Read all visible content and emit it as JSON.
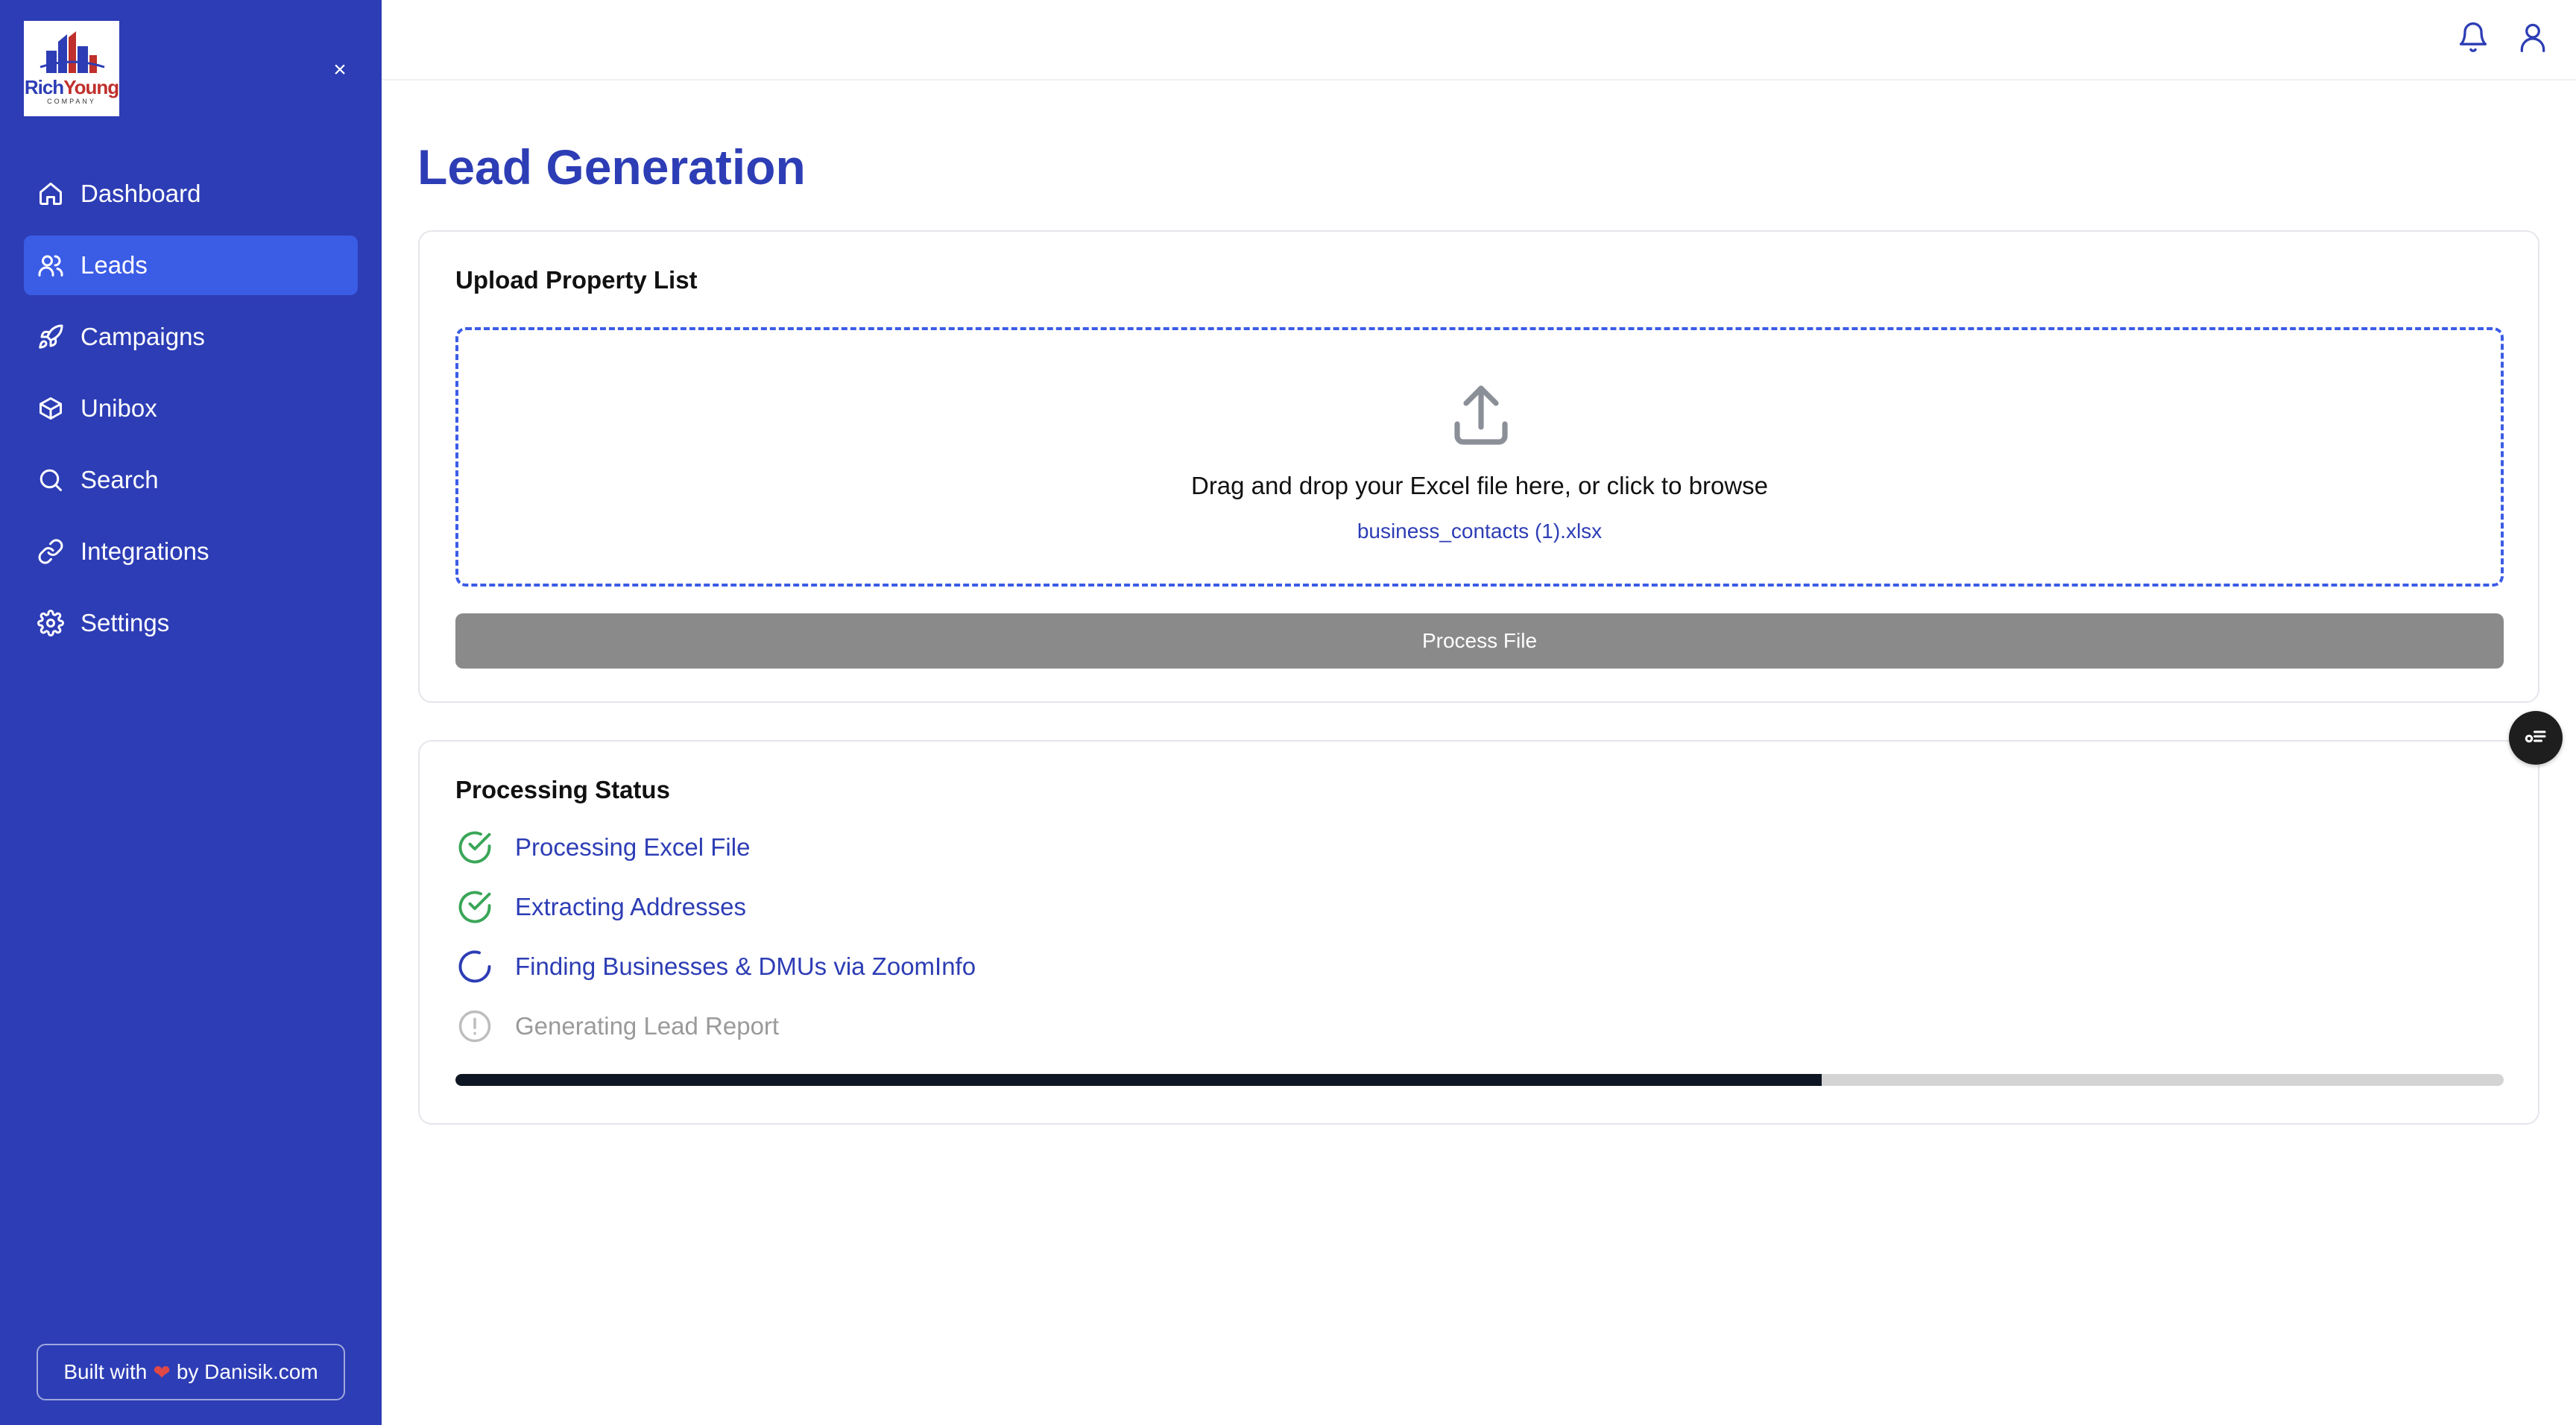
{
  "brand": {
    "logo_word_1": "Rich",
    "logo_word_2": "Young",
    "logo_sub": "COMPANY",
    "colors": {
      "sidebar": "#2d3db5",
      "active": "#3b5ce5",
      "accent": "#2d3db5",
      "success": "#3aa657"
    }
  },
  "sidebar": {
    "close_label": "×",
    "items": [
      {
        "label": "Dashboard",
        "icon": "home-icon",
        "active": false
      },
      {
        "label": "Leads",
        "icon": "users-icon",
        "active": true
      },
      {
        "label": "Campaigns",
        "icon": "rocket-icon",
        "active": false
      },
      {
        "label": "Unibox",
        "icon": "box-icon",
        "active": false
      },
      {
        "label": "Search",
        "icon": "search-icon",
        "active": false
      },
      {
        "label": "Integrations",
        "icon": "link-icon",
        "active": false
      },
      {
        "label": "Settings",
        "icon": "gear-icon",
        "active": false
      }
    ],
    "footer": {
      "prefix": "Built with",
      "heart": "❤",
      "suffix": "by Danisik.com"
    }
  },
  "header": {
    "icons": [
      "bell-icon",
      "user-icon"
    ]
  },
  "main": {
    "title": "Lead Generation",
    "upload": {
      "title": "Upload Property List",
      "drop_text": "Drag and drop your Excel file here, or click to browse",
      "file_name": "business_contacts (1).xlsx",
      "button_label": "Process File"
    },
    "status": {
      "title": "Processing Status",
      "steps": [
        {
          "label": "Processing Excel File",
          "state": "done"
        },
        {
          "label": "Extracting Addresses",
          "state": "done"
        },
        {
          "label": "Finding Businesses & DMUs via ZoomInfo",
          "state": "in-progress"
        },
        {
          "label": "Generating Lead Report",
          "state": "pending"
        }
      ],
      "progress": 0.667
    }
  },
  "floating_button": {
    "icon": "list-filter-icon"
  }
}
